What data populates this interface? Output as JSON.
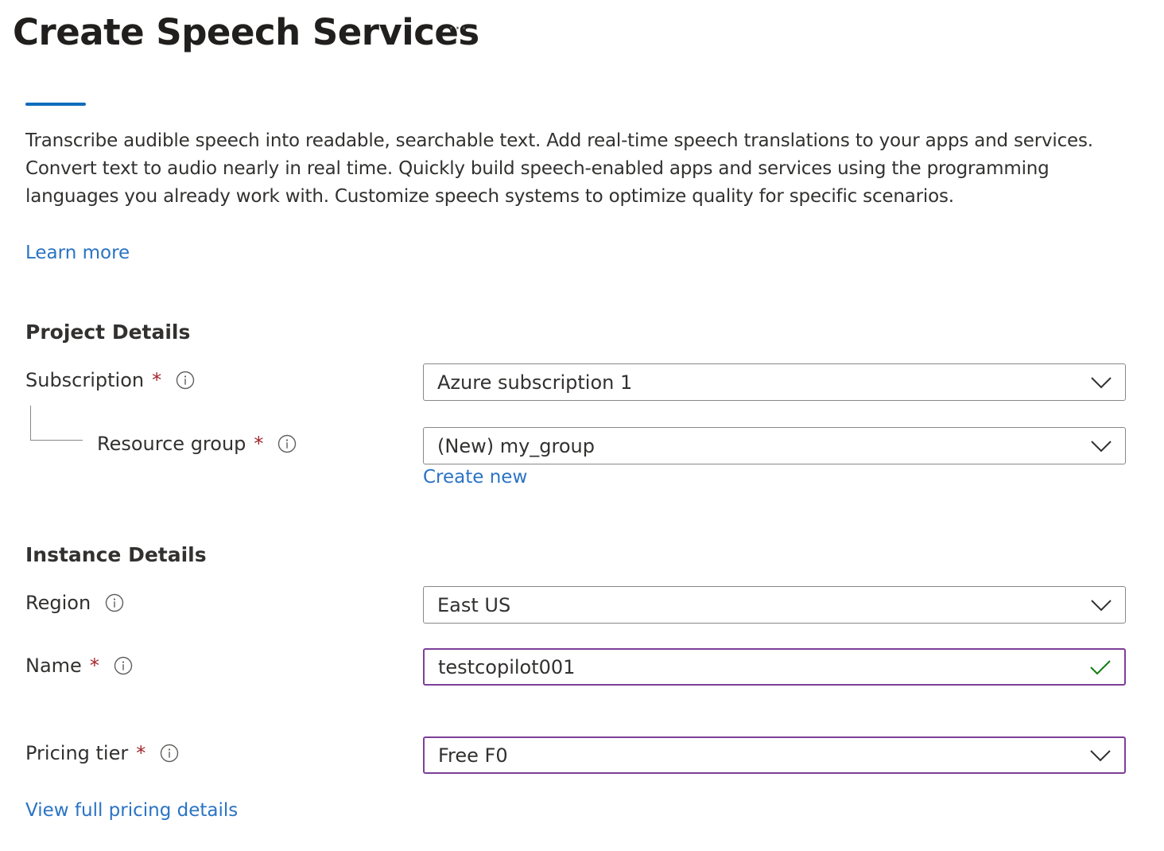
{
  "header": {
    "title": "Create Speech Services",
    "more_label": "···"
  },
  "description": "Transcribe audible speech into readable, searchable text. Add real-time speech translations to your apps and services. Convert text to audio nearly in real time. Quickly build speech-enabled apps and services using the programming languages you already work with. Customize speech systems to optimize quality for specific scenarios.",
  "learn_more_link": "Learn more",
  "project_details": {
    "heading": "Project Details",
    "subscription": {
      "label": "Subscription",
      "required": "*",
      "value": "Azure subscription 1"
    },
    "resource_group": {
      "label": "Resource group",
      "required": "*",
      "value": "(New) my_group",
      "create_new_link": "Create new"
    }
  },
  "instance_details": {
    "heading": "Instance Details",
    "region": {
      "label": "Region",
      "value": "East US"
    },
    "name": {
      "label": "Name",
      "required": "*",
      "value": "testcopilot001"
    },
    "pricing_tier": {
      "label": "Pricing tier",
      "required": "*",
      "value": "Free F0"
    }
  },
  "pricing_link": "View full pricing details",
  "icons": {
    "info": "info-icon",
    "chevron": "chevron-down-icon",
    "valid": "checkmark-icon"
  },
  "colors": {
    "link": "#2a73c4",
    "required": "#a4262c",
    "focus_border": "#7d3f98",
    "valid_check": "#107c10",
    "tab_indicator": "#0f6cbd"
  }
}
